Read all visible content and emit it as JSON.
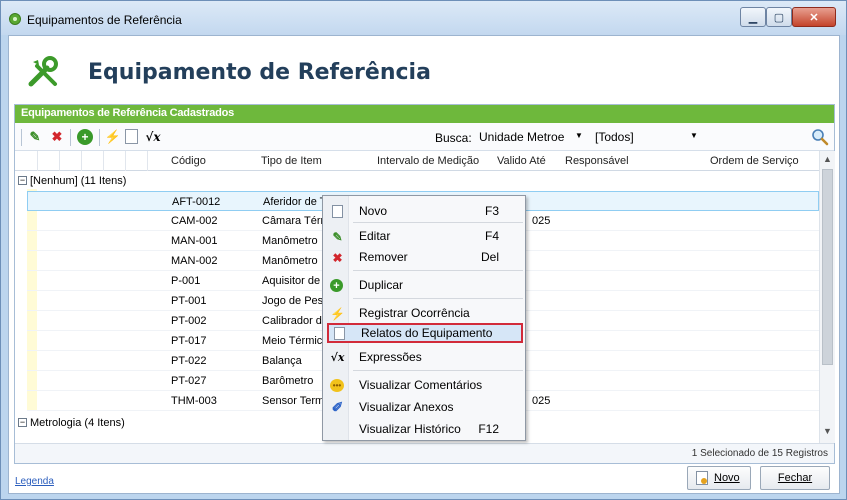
{
  "window": {
    "title": "Equipamentos de Referência"
  },
  "page": {
    "title": "Equipamento de Referência"
  },
  "grid": {
    "title": "Equipamentos de Referência Cadastrados",
    "search_label": "Busca:",
    "search_field": "Unidade Metroe",
    "filter_value": "[Todos]",
    "columns": [
      "Código",
      "Tipo de Item",
      "Intervalo de Medição",
      "Valido Até",
      "Responsável",
      "Ordem de Serviço"
    ],
    "groups": [
      {
        "label": "[Nenhum] (11 Itens)"
      },
      {
        "label": "Metrologia (4 Itens)"
      }
    ],
    "rows": [
      {
        "code": "AFT-0012",
        "type": "Aferidor de To",
        "valid": ""
      },
      {
        "code": "CAM-002",
        "type": "Câmara Térmic",
        "valid": "025"
      },
      {
        "code": "MAN-001",
        "type": "Manômetro",
        "valid": ""
      },
      {
        "code": "MAN-002",
        "type": "Manômetro",
        "valid": ""
      },
      {
        "code": "P-001",
        "type": "Aquisitor de D",
        "valid": ""
      },
      {
        "code": "PT-001",
        "type": "Jogo de Peso",
        "valid": ""
      },
      {
        "code": "PT-002",
        "type": "Calibrador de",
        "valid": ""
      },
      {
        "code": "PT-017",
        "type": "Meio Térmico",
        "valid": ""
      },
      {
        "code": "PT-022",
        "type": "Balança",
        "valid": ""
      },
      {
        "code": "PT-027",
        "type": "Barômetro",
        "valid": ""
      },
      {
        "code": "THM-003",
        "type": "Sensor Termic",
        "valid": "025"
      }
    ],
    "status": "1 Selecionado de 15 Registros"
  },
  "context_menu": {
    "items": [
      {
        "label": "Novo",
        "key": "F3",
        "icon": "new-doc-icon"
      },
      {
        "label": "Editar",
        "key": "F4",
        "icon": "edit-icon"
      },
      {
        "label": "Remover",
        "key": "Del",
        "icon": "remove-icon"
      },
      {
        "label": "Duplicar",
        "key": "",
        "icon": "duplicate-icon"
      },
      {
        "label": "Registrar Ocorrência",
        "key": "",
        "icon": "lightning-icon"
      },
      {
        "label": "Relatos do Equipamento",
        "key": "",
        "icon": "report-icon"
      },
      {
        "label": "Expressões",
        "key": "",
        "icon": "sqrt-icon"
      },
      {
        "label": "Visualizar Comentários",
        "key": "",
        "icon": "comment-icon"
      },
      {
        "label": "Visualizar Anexos",
        "key": "",
        "icon": "attachment-icon"
      },
      {
        "label": "Visualizar Histórico",
        "key": "F12",
        "icon": ""
      }
    ]
  },
  "footer": {
    "legend": "Legenda",
    "new_label": "Novo",
    "close_label": "Fechar"
  },
  "colors": {
    "accent_green": "#6eb83c",
    "title_text": "#233f5b",
    "highlight_border": "#d22b3a"
  }
}
